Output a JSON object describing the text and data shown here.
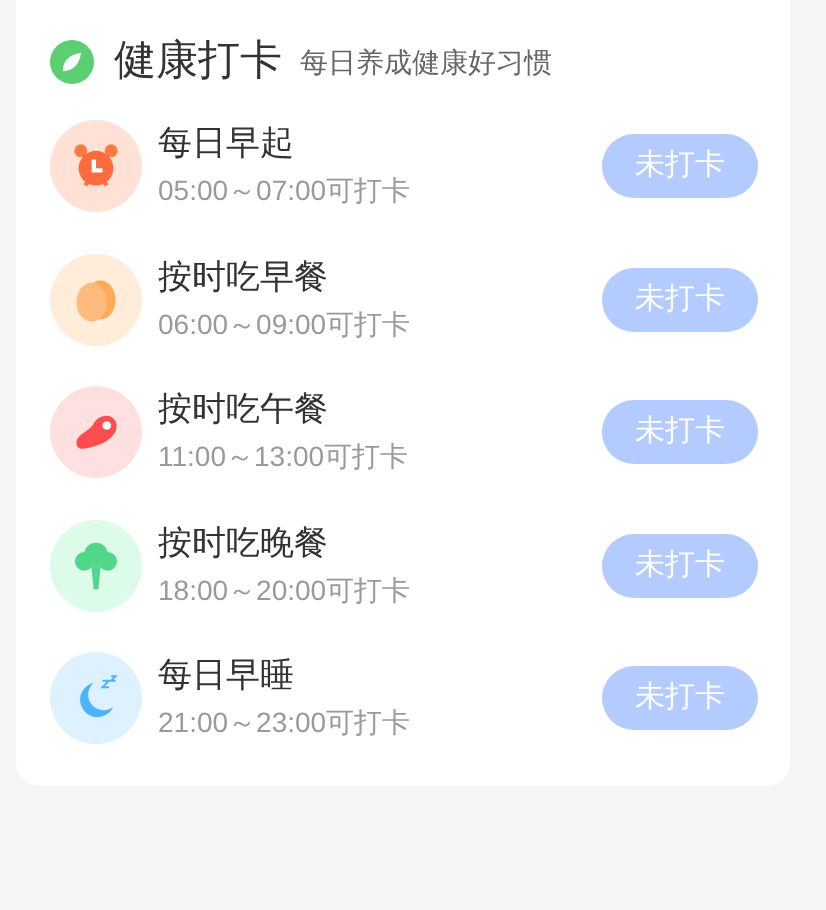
{
  "header": {
    "title": "健康打卡",
    "subtitle": "每日养成健康好习惯"
  },
  "tasks": [
    {
      "kind": "alarm",
      "name": "每日早起",
      "time": "05:00～07:00可打卡",
      "button": "未打卡",
      "checked": false
    },
    {
      "kind": "egg",
      "name": "按时吃早餐",
      "time": "06:00～09:00可打卡",
      "button": "未打卡",
      "checked": false
    },
    {
      "kind": "meat",
      "name": "按时吃午餐",
      "time": "11:00～13:00可打卡",
      "button": "未打卡",
      "checked": false
    },
    {
      "kind": "broccoli",
      "name": "按时吃晚餐",
      "time": "18:00～20:00可打卡",
      "button": "未打卡",
      "checked": false
    },
    {
      "kind": "moon",
      "name": "每日早睡",
      "time": "21:00～23:00可打卡",
      "button": "未打卡",
      "checked": false
    }
  ]
}
